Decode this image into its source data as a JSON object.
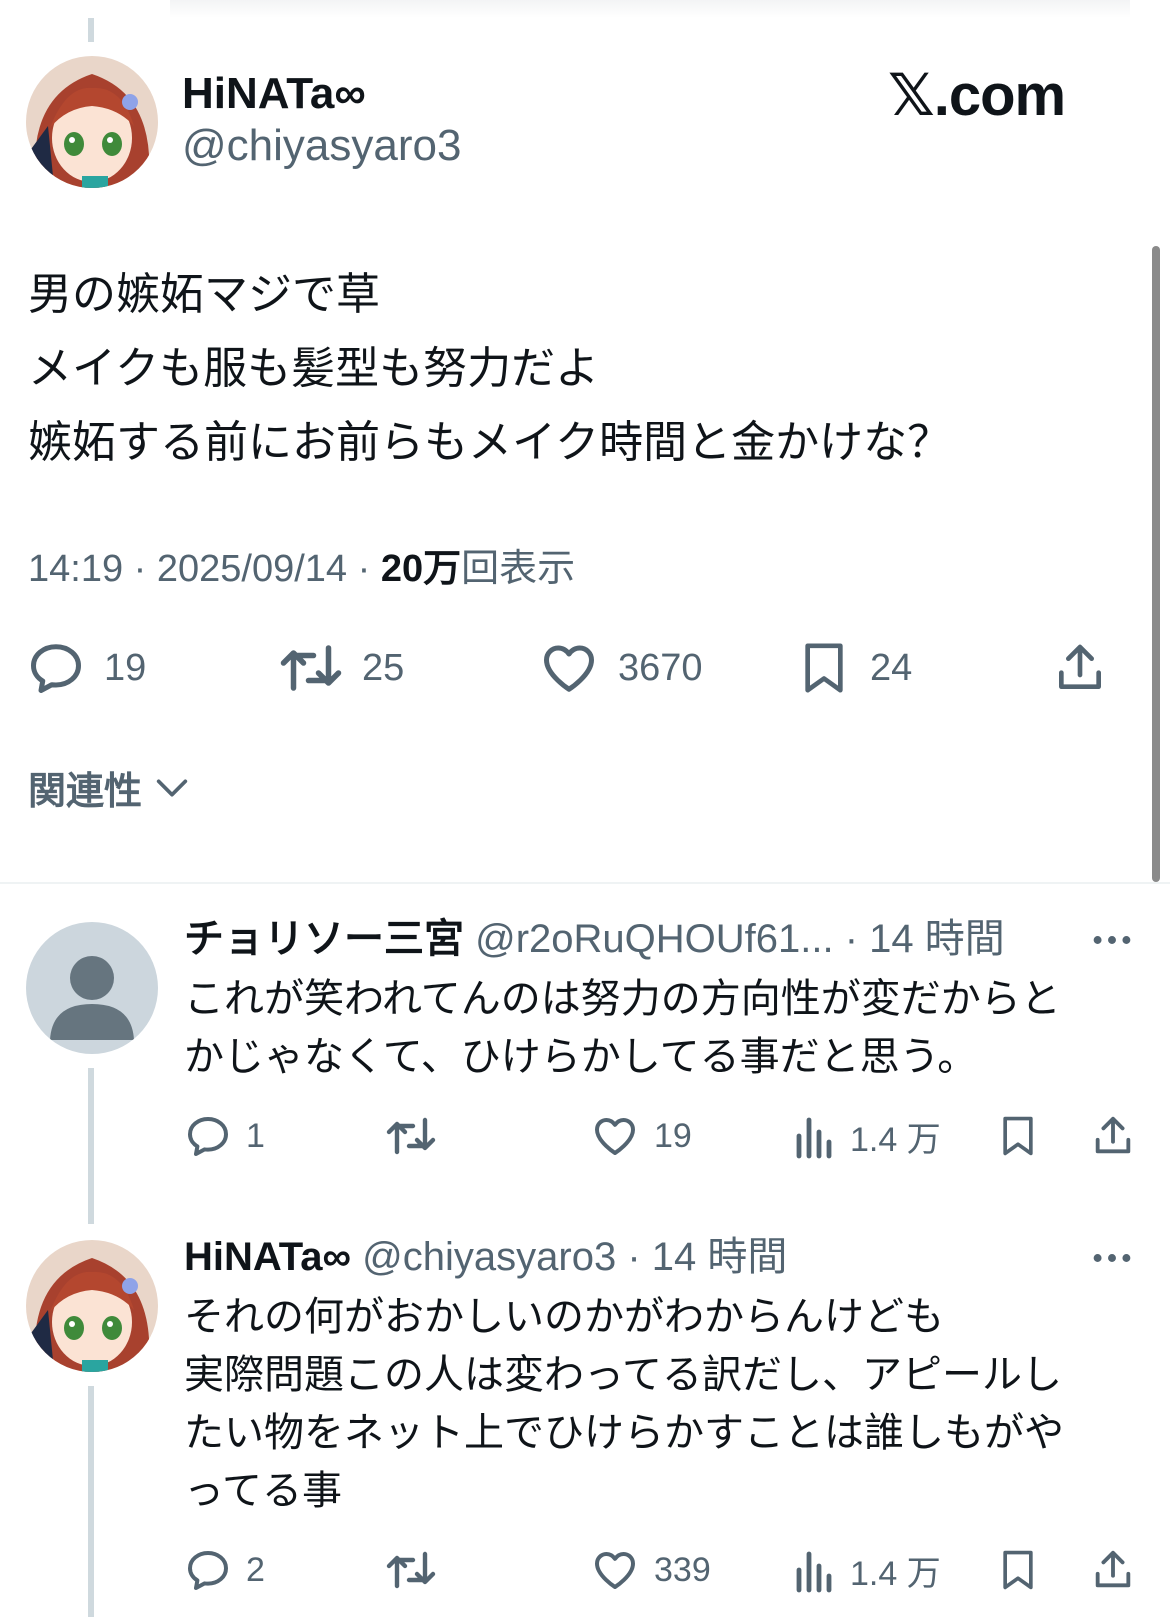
{
  "main_tweet": {
    "display_name": "HiNATa∞",
    "handle": "@chiyasyaro3",
    "brand": "𝕏.com",
    "lines": [
      "男の嫉妬マジで草",
      "メイクも服も髪型も努力だよ",
      "嫉妬する前にお前らもメイク時間と金かけな？"
    ],
    "time": "14:19",
    "date": "2025/09/14",
    "views_count": "20万",
    "views_label": "回表示",
    "replies": "19",
    "reposts": "25",
    "likes": "3670",
    "bookmarks": "24"
  },
  "sort": {
    "label": "関連性"
  },
  "replies": [
    {
      "display_name": "チョリソー三宮",
      "handle": "@r2oRuQHOUf61...",
      "time": "14 時間",
      "lines": [
        "これが笑われてんのは努力の方向性が変だからと",
        "かじゃなくて、ひけらかしてる事だと思う。"
      ],
      "reply_count": "1",
      "like_count": "19",
      "view_count": "1.4 万"
    },
    {
      "display_name": "HiNATa∞",
      "handle": "@chiyasyaro3",
      "time": "14 時間",
      "lines": [
        "それの何がおかしいのかがわからんけども",
        "実際問題この人は変わってる訳だし、アピールし",
        "たい物をネット上でひけらかすことは誰しもがや",
        "ってる事"
      ],
      "reply_count": "2",
      "like_count": "339",
      "view_count": "1.4 万"
    }
  ],
  "colors": {
    "text": "#0f1419",
    "secondary": "#536471",
    "divider": "#eff3f4",
    "thread": "#cfd9de"
  },
  "icons": [
    "reply-icon",
    "repost-icon",
    "like-icon",
    "bookmark-icon",
    "share-icon",
    "views-icon",
    "more-icon",
    "chevron-down-icon"
  ]
}
